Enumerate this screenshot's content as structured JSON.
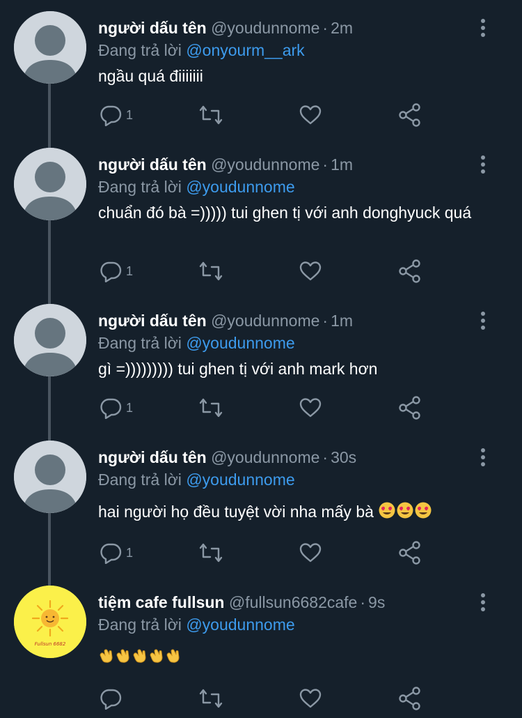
{
  "colors": {
    "background": "#15202b",
    "muted": "#8b98a5",
    "mention": "#3d9bed",
    "thread_line": "#4a5560"
  },
  "replies": [
    {
      "name": "người dấu tên",
      "handle": "@youdunnome",
      "separator": "·",
      "time": "2m",
      "replying_label": "Đang trả lời",
      "replying_to": "@onyourm__ark",
      "text": "ngầu quá điiiiiii",
      "reply_count": "1",
      "avatar": "default-avatar-icon"
    },
    {
      "name": "người dấu tên",
      "handle": "@youdunnome",
      "separator": "·",
      "time": "1m",
      "replying_label": "Đang trả lời",
      "replying_to": "@youdunnome",
      "text": "chuẩn đó bà =))))) tui ghen tị với anh donghyuck quá",
      "reply_count": "1",
      "avatar": "default-avatar-icon"
    },
    {
      "name": "người dấu tên",
      "handle": "@youdunnome",
      "separator": "·",
      "time": "1m",
      "replying_label": "Đang trả lời",
      "replying_to": "@youdunnome",
      "text": "gì =))))))))) tui ghen tị với anh mark hơn",
      "reply_count": "1",
      "avatar": "default-avatar-icon"
    },
    {
      "name": "người dấu tên",
      "handle": "@youdunnome",
      "separator": "·",
      "time": "30s",
      "replying_label": "Đang trả lời",
      "replying_to": "@youdunnome",
      "text": "hai người họ đều tuyệt vời nha mấy bà ",
      "emoji": "😍😍😍",
      "reply_count": "1",
      "avatar": "default-avatar-icon"
    },
    {
      "name": "tiệm cafe fullsun",
      "handle": "@fullsun6682cafe",
      "separator": "·",
      "time": "9s",
      "replying_label": "Đang trả lời",
      "replying_to": "@youdunnome",
      "text": "",
      "emoji": "👏👏👏👏👏",
      "reply_count": "",
      "avatar": "sun-logo-icon",
      "avatar_caption": "Fullsun 6682"
    }
  ]
}
